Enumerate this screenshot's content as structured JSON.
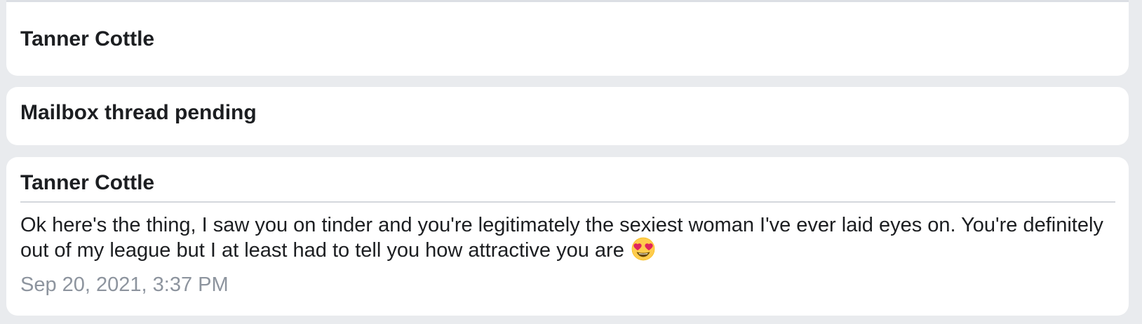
{
  "messages": [
    {
      "sender": "Tanner Cottle"
    },
    {
      "sender": "Mailbox thread pending"
    },
    {
      "sender": "Tanner Cottle",
      "text": "Ok here's the thing, I saw you on tinder and you're legitimately the sexiest woman I've ever laid eyes on. You're definitely out of my league but I at least had to tell you how attractive you are",
      "emoji": "heart-eyes-emoji",
      "timestamp": "Sep 20, 2021, 3:37 PM"
    }
  ],
  "colors": {
    "background": "#e9ebee",
    "card": "#ffffff",
    "text": "#1c1e21",
    "timestamp": "#8d949e",
    "divider": "#d4d7dc"
  }
}
